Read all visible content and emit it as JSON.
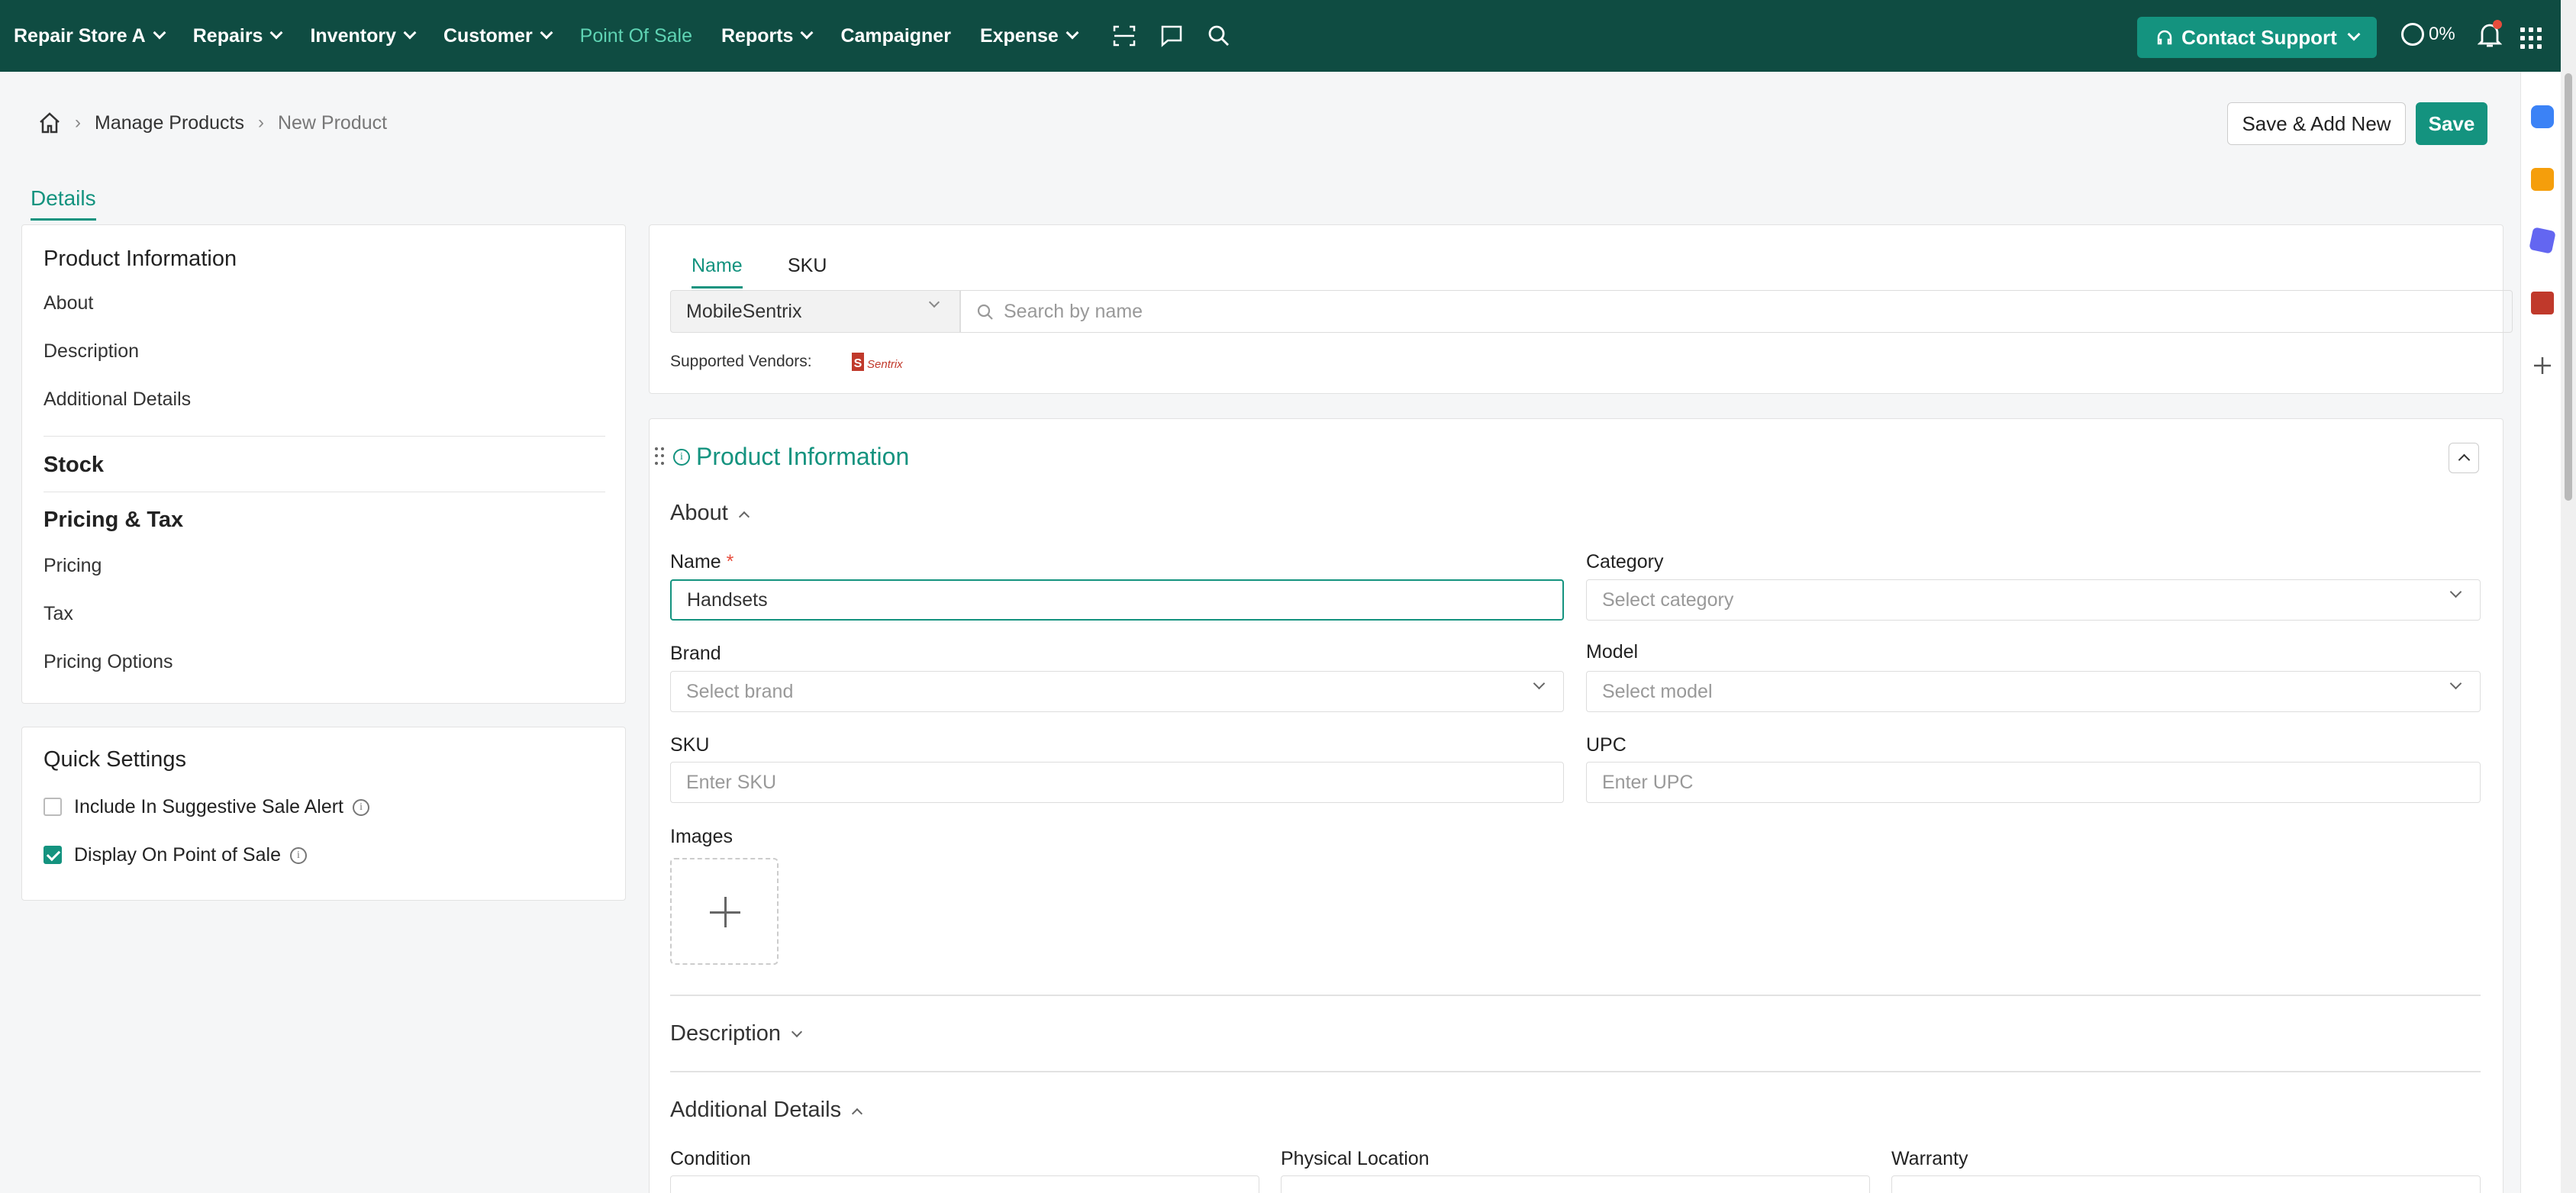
{
  "topnav": {
    "store": "Repair Store A",
    "items": [
      {
        "label": "Repairs"
      },
      {
        "label": "Inventory"
      },
      {
        "label": "Customer"
      },
      {
        "label": "Point Of Sale"
      },
      {
        "label": "Reports"
      },
      {
        "label": "Campaigner"
      },
      {
        "label": "Expense"
      }
    ],
    "contact_support": "Contact Support",
    "progress": "0%"
  },
  "breadcrumb": {
    "parent": "Manage Products",
    "current": "New Product"
  },
  "actions": {
    "save_add_new": "Save & Add New",
    "save": "Save"
  },
  "page_tab": "Details",
  "left_nav": {
    "product_information": "Product Information",
    "about": "About",
    "description": "Description",
    "additional_details": "Additional Details",
    "stock": "Stock",
    "pricing_tax": "Pricing & Tax",
    "pricing": "Pricing",
    "tax": "Tax",
    "pricing_options": "Pricing Options"
  },
  "quick_settings": {
    "title": "Quick Settings",
    "suggestive": {
      "label": "Include In Suggestive Sale Alert",
      "checked": false
    },
    "display_pos": {
      "label": "Display On Point of Sale",
      "checked": true
    }
  },
  "search": {
    "tabs": [
      "Name",
      "SKU"
    ],
    "vendor": "MobileSentrix",
    "placeholder": "Search by name",
    "supported_vendors": "Supported Vendors:",
    "vendor_logo_text": "Sentrix"
  },
  "product_info": {
    "title": "Product Information",
    "about": "About",
    "name_label": "Name",
    "name_required": "*",
    "name_value": "Handsets",
    "category_label": "Category",
    "category_placeholder": "Select category",
    "brand_label": "Brand",
    "brand_placeholder": "Select brand",
    "model_label": "Model",
    "model_placeholder": "Select model",
    "sku_label": "SKU",
    "sku_placeholder": "Enter SKU",
    "upc_label": "UPC",
    "upc_placeholder": "Enter UPC",
    "images_label": "Images",
    "description": "Description",
    "additional_details": "Additional Details",
    "condition_label": "Condition",
    "physical_location_label": "Physical Location",
    "warranty_label": "Warranty"
  },
  "colors": {
    "brand": "#0f4c42",
    "accent": "#14937f",
    "active_nav": "#5fd4b4"
  }
}
